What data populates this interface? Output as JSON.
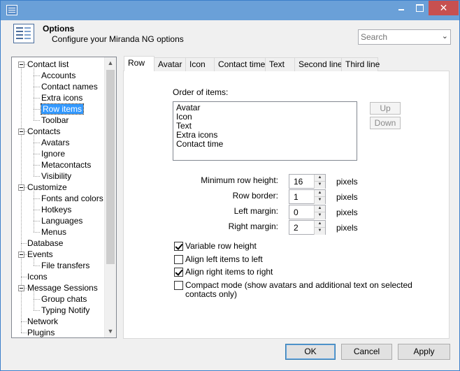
{
  "window": {
    "icon": "app-icon",
    "controls": {
      "minimize": "minimize-icon",
      "maximize": "maximize-icon",
      "close_glyph": "✕"
    }
  },
  "header": {
    "title": "Options",
    "subtitle": "Configure your Miranda NG options",
    "icon": "options-icon"
  },
  "search": {
    "placeholder": "Search",
    "chevron": "⌄"
  },
  "tree": {
    "scroll_up": "▲",
    "scroll_down": "▼",
    "items": [
      {
        "label": "Contact list",
        "level": 0,
        "expander": true
      },
      {
        "label": "Accounts",
        "level": 1
      },
      {
        "label": "Contact names",
        "level": 1
      },
      {
        "label": "Extra icons",
        "level": 1
      },
      {
        "label": "Row items",
        "level": 1,
        "selected": true
      },
      {
        "label": "Toolbar",
        "level": 1
      },
      {
        "label": "Contacts",
        "level": 0,
        "expander": true
      },
      {
        "label": "Avatars",
        "level": 1
      },
      {
        "label": "Ignore",
        "level": 1
      },
      {
        "label": "Metacontacts",
        "level": 1
      },
      {
        "label": "Visibility",
        "level": 1
      },
      {
        "label": "Customize",
        "level": 0,
        "expander": true
      },
      {
        "label": "Fonts and colors",
        "level": 1
      },
      {
        "label": "Hotkeys",
        "level": 1
      },
      {
        "label": "Languages",
        "level": 1
      },
      {
        "label": "Menus",
        "level": 1
      },
      {
        "label": "Database",
        "level": 0
      },
      {
        "label": "Events",
        "level": 0,
        "expander": true
      },
      {
        "label": "File transfers",
        "level": 1
      },
      {
        "label": "Icons",
        "level": 0
      },
      {
        "label": "Message Sessions",
        "level": 0,
        "expander": true
      },
      {
        "label": "Group chats",
        "level": 1
      },
      {
        "label": "Typing Notify",
        "level": 1
      },
      {
        "label": "Network",
        "level": 0
      },
      {
        "label": "Plugins",
        "level": 0
      }
    ]
  },
  "tabs": [
    {
      "label": "Row",
      "active": true
    },
    {
      "label": "Avatar"
    },
    {
      "label": "Icon"
    },
    {
      "label": "Contact time"
    },
    {
      "label": "Text"
    },
    {
      "label": "Second line"
    },
    {
      "label": "Third line"
    }
  ],
  "row_tab": {
    "order_label": "Order of items:",
    "order_items": [
      "Avatar",
      "Icon",
      "Text",
      "Extra icons",
      "Contact time"
    ],
    "up_label": "Up",
    "down_label": "Down",
    "fields": [
      {
        "label": "Minimum row height:",
        "value": "16",
        "unit": "pixels"
      },
      {
        "label": "Row border:",
        "value": "1",
        "unit": "pixels"
      },
      {
        "label": "Left margin:",
        "value": "0",
        "unit": "pixels"
      },
      {
        "label": "Right margin:",
        "value": "2",
        "unit": "pixels"
      }
    ],
    "spin_up": "▲",
    "spin_down": "▼",
    "checkboxes": [
      {
        "label": "Variable row height",
        "checked": true
      },
      {
        "label": "Align left items to left",
        "checked": false
      },
      {
        "label": "Align right items to right",
        "checked": true
      },
      {
        "label_line1": "Compact mode (show avatars and additional text on selected",
        "label_line2": "contacts only)",
        "checked": false
      }
    ]
  },
  "buttons": {
    "ok": "OK",
    "cancel": "Cancel",
    "apply": "Apply"
  },
  "colors": {
    "titlebar": "#6aa0d8",
    "selection": "#3399ff",
    "close": "#c75050"
  }
}
